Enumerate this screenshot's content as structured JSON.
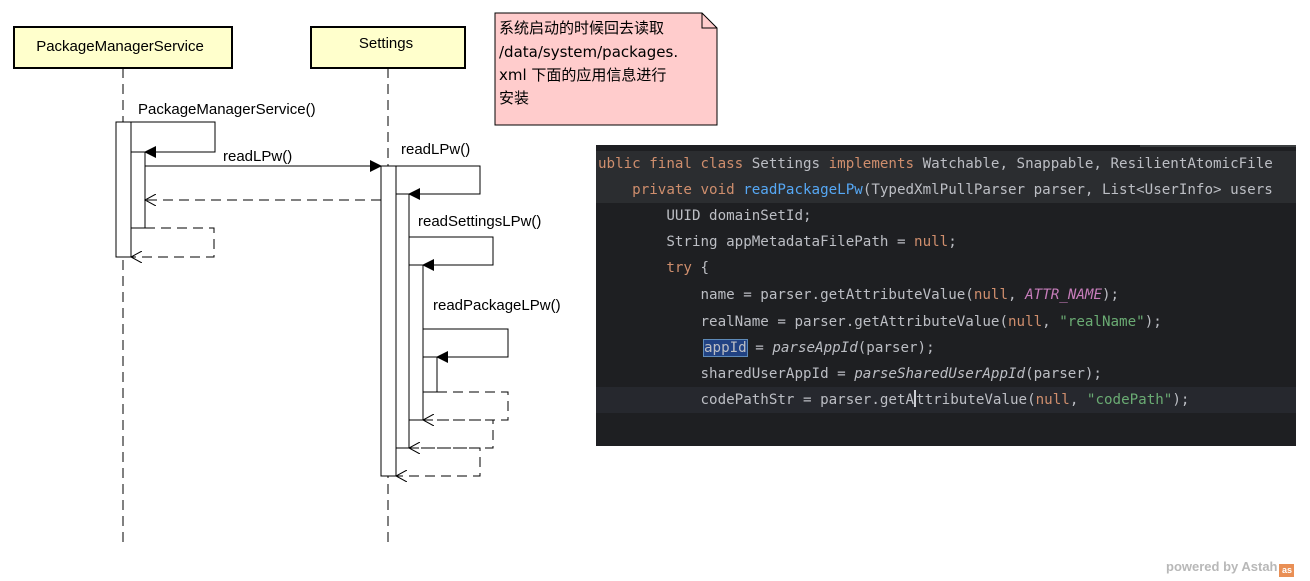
{
  "lifelines": [
    {
      "name": "PackageManagerService"
    },
    {
      "name": "Settings"
    }
  ],
  "messages": {
    "pms_ctor": "PackageManagerService()",
    "read_lpw_call": "readLPw()",
    "read_lpw_self": "readLPw()",
    "read_settings": "readSettingsLPw()",
    "read_package": "readPackageLPw()"
  },
  "note": {
    "lines": [
      "系统启动的时候回去读取",
      "/data/system/packages.",
      "xml  下面的应用信息进行",
      "安装"
    ],
    "fill": "#ffcccc"
  },
  "colors": {
    "lifeline_fill": "#ffffcc",
    "code_bg": "#1e1f22",
    "keyword": "#cf8e6d",
    "function": "#56a8f5",
    "string": "#6aab73",
    "constant": "#c77dbb"
  },
  "code": {
    "lines": [
      [
        [
          "kw",
          "ublic final class "
        ],
        [
          "p",
          "Settings "
        ],
        [
          "kw",
          "implements "
        ],
        [
          "p",
          "Watchable, Snappable, ResilientAtomicFile"
        ]
      ],
      [
        [
          "p",
          "    "
        ],
        [
          "kw",
          "private void "
        ],
        [
          "fn",
          "readPackageLPw"
        ],
        [
          "p",
          "(TypedXmlPullParser parser, List<UserInfo> users"
        ]
      ],
      [
        [
          "p",
          "        UUID domainSetId;"
        ]
      ],
      [
        [
          "p",
          "        String appMetadataFilePath = "
        ],
        [
          "kw",
          "null"
        ],
        [
          "p",
          ";"
        ]
      ],
      [
        [
          "p",
          "        "
        ],
        [
          "kw",
          "try "
        ],
        [
          "p",
          "{"
        ]
      ],
      [
        [
          "p",
          "            name = parser.getAttributeValue("
        ],
        [
          "kw",
          "null"
        ],
        [
          "p",
          ", "
        ],
        [
          "const",
          "ATTR_NAME"
        ],
        [
          "p",
          ");"
        ]
      ],
      [
        [
          "p",
          "            realName = parser.getAttributeValue("
        ],
        [
          "kw",
          "null"
        ],
        [
          "p",
          ", "
        ],
        [
          "str",
          "\"realName\""
        ],
        [
          "p",
          ");"
        ]
      ],
      [
        [
          "hl",
          "appId"
        ],
        [
          "p",
          " = "
        ],
        [
          "it",
          "parseAppId"
        ],
        [
          "p",
          "(parser);"
        ]
      ],
      [
        [
          "p",
          "            sharedUserAppId = "
        ],
        [
          "it",
          "parseSharedUserAppId"
        ],
        [
          "p",
          "(parser);"
        ]
      ],
      [
        [
          "p",
          "            codePathStr = parser.getA"
        ],
        [
          "caret",
          ""
        ],
        [
          "p",
          "ttributeValue("
        ],
        [
          "kw",
          "null"
        ],
        [
          "p",
          ", "
        ],
        [
          "str",
          "\"codePath\""
        ],
        [
          "p",
          ");"
        ]
      ]
    ]
  },
  "footer": {
    "text": "powered by Astah",
    "logo": "as"
  }
}
